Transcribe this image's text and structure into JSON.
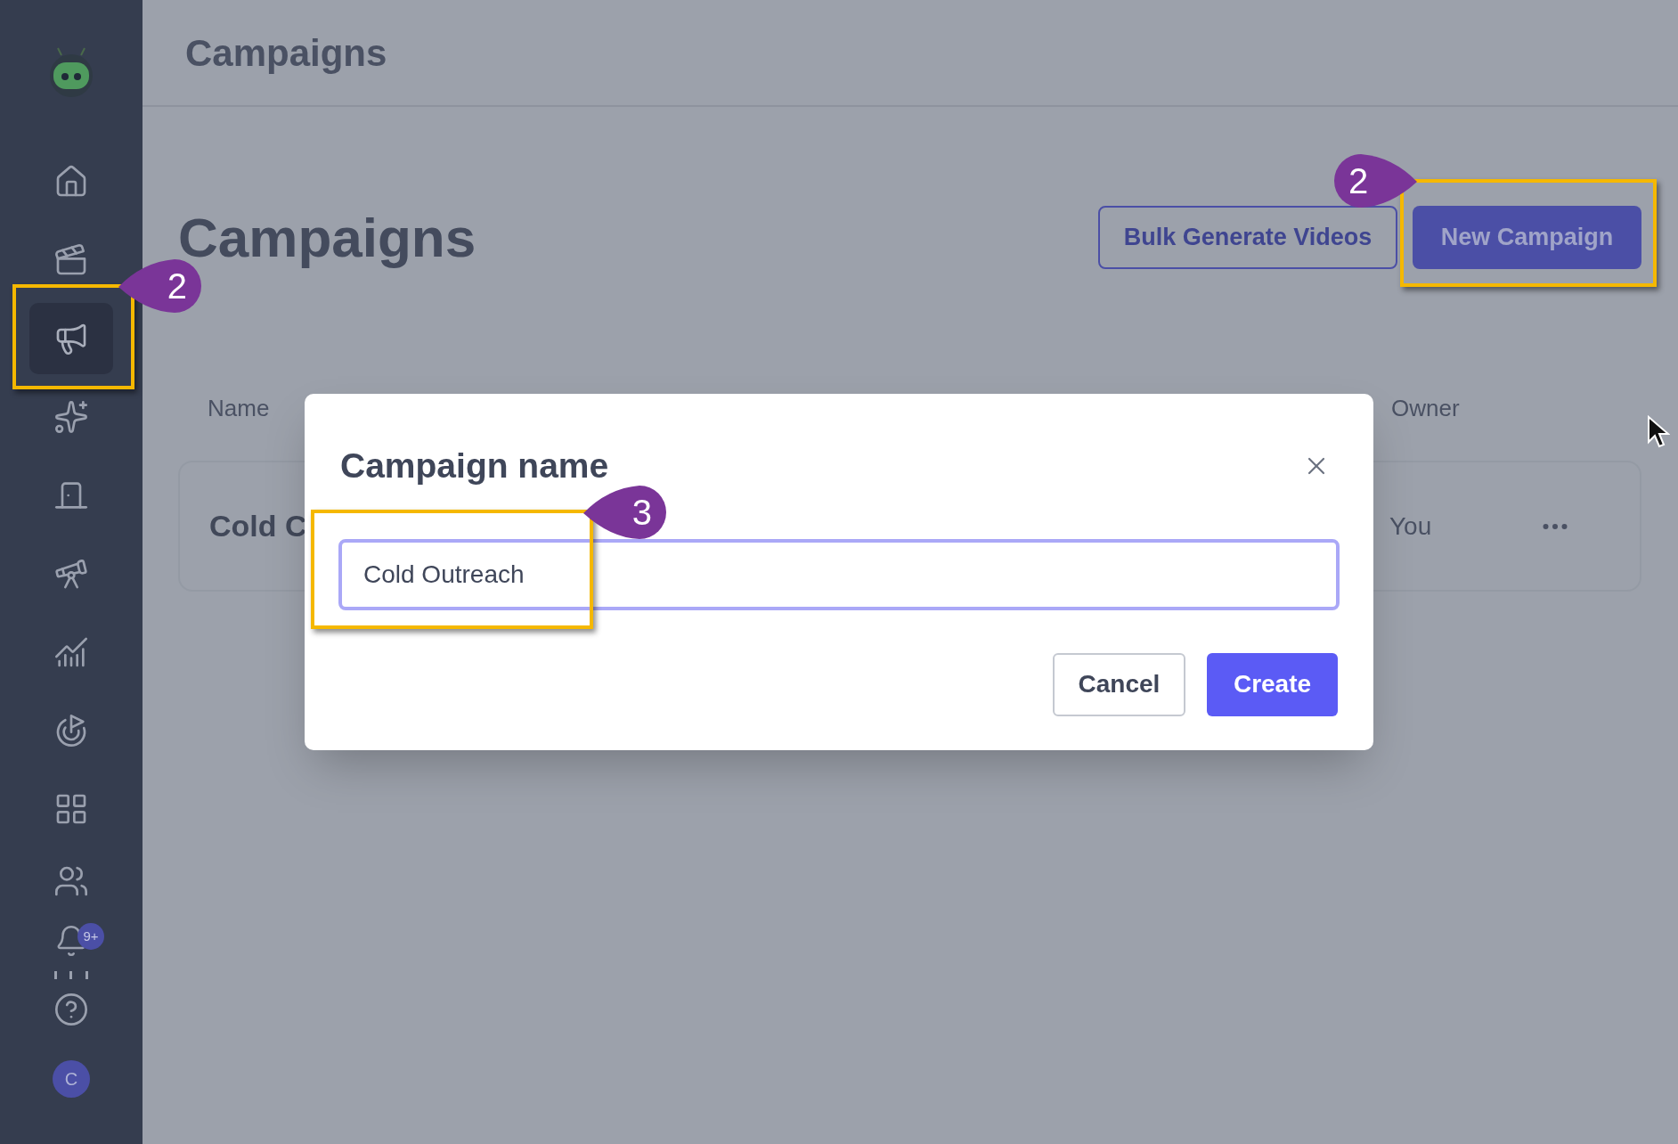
{
  "sidebar": {
    "items": [
      {
        "kind": "home",
        "selected": false
      },
      {
        "kind": "videos",
        "selected": false
      },
      {
        "kind": "campaigns",
        "selected": true
      },
      {
        "kind": "sparkles",
        "selected": false
      },
      {
        "kind": "door",
        "selected": false
      },
      {
        "kind": "telescope",
        "selected": false
      },
      {
        "kind": "chart",
        "selected": false
      },
      {
        "kind": "target",
        "selected": false
      },
      {
        "kind": "grid",
        "selected": false
      },
      {
        "kind": "users",
        "selected": false
      }
    ],
    "notifications_badge": "9+",
    "avatar": "C"
  },
  "header": {
    "title": "Campaigns"
  },
  "page": {
    "title": "Campaigns",
    "buttons": [
      {
        "label": "Bulk Generate Videos",
        "kind": "outline"
      },
      {
        "label": "New Campaign",
        "kind": "primary"
      }
    ]
  },
  "table": {
    "columns": [
      "Name",
      "Owner"
    ],
    "rows": [
      {
        "name": "Cold C",
        "owner": "You"
      }
    ]
  },
  "dialog": {
    "title": "Campaign name",
    "input_value": "Cold Outreach",
    "buttons": [
      {
        "label": "Cancel",
        "kind": "secondary"
      },
      {
        "label": "Create",
        "kind": "primary"
      }
    ]
  },
  "annotations": [
    {
      "number": "2",
      "kind": "left"
    },
    {
      "number": "2",
      "kind": "right"
    },
    {
      "number": "3",
      "kind": "left"
    }
  ]
}
